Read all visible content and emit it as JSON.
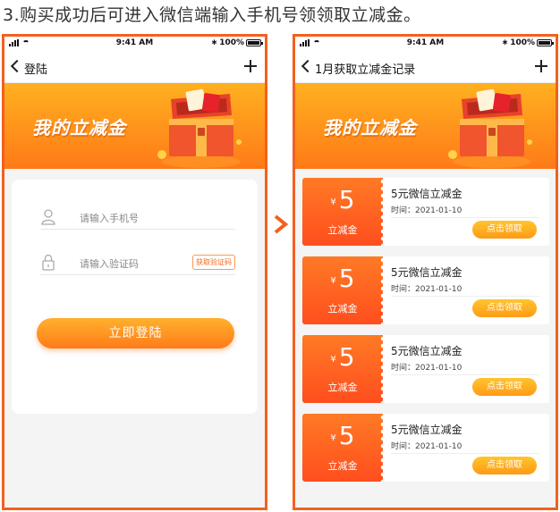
{
  "caption": "3.购买成功后可进入微信端输入手机号领领取立减金。",
  "statusbar": {
    "time": "9:41 AM",
    "battery": "100%"
  },
  "left_screen": {
    "nav_title": "登陆",
    "banner_title": "我的立减金",
    "phone_placeholder": "请输入手机号",
    "code_placeholder": "请输入验证码",
    "get_code_label": "获取验证码",
    "login_label": "立即登陆"
  },
  "right_screen": {
    "nav_title": "1月获取立减金记录",
    "banner_title": "我的立减金",
    "coupons": [
      {
        "currency": "¥",
        "amount": "5",
        "unit": "立减金",
        "name": "5元微信立减金",
        "time": "时间：2021-01-10",
        "button": "点击领取"
      },
      {
        "currency": "¥",
        "amount": "5",
        "unit": "立减金",
        "name": "5元微信立减金",
        "time": "时间：2021-01-10",
        "button": "点击领取"
      },
      {
        "currency": "¥",
        "amount": "5",
        "unit": "立减金",
        "name": "5元微信立减金",
        "time": "时间：2021-01-10",
        "button": "点击领取"
      },
      {
        "currency": "¥",
        "amount": "5",
        "unit": "立减金",
        "name": "5元微信立减金",
        "time": "时间：2021-01-10",
        "button": "点击领取"
      }
    ]
  },
  "colors": {
    "accent": "#f3601f",
    "banner_top": "#ffb020",
    "banner_bottom": "#ff7a18",
    "button": "#ff9a16"
  },
  "icons": [
    "signal-icon",
    "wifi-icon",
    "bluetooth-icon",
    "battery-icon",
    "back-chevron-icon",
    "plus-icon",
    "user-icon",
    "lock-icon",
    "treasure-chest-icon",
    "next-arrow-icon"
  ]
}
